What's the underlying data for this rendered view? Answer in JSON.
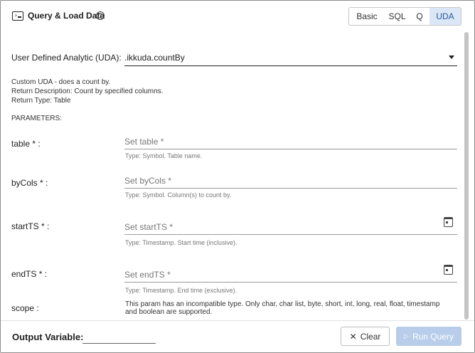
{
  "header": {
    "title": "Query & Load Data",
    "modes": [
      {
        "label": "Basic",
        "selected": false
      },
      {
        "label": "SQL",
        "selected": false
      },
      {
        "label": "Q",
        "selected": false
      },
      {
        "label": "UDA",
        "selected": true
      }
    ]
  },
  "uda": {
    "label": "User Defined Analytic (UDA):",
    "value": ".ikkuda.countBy",
    "description": [
      "Custom UDA - does a count by.",
      "Return Description: Count by specified columns.",
      "Return Type: Table"
    ],
    "parameters_heading": "PARAMETERS:"
  },
  "params": [
    {
      "label": "table * :",
      "placeholder": "Set table *",
      "hint": "Type: Symbol. Table name."
    },
    {
      "label": "byCols * :",
      "placeholder": "Set byCols *",
      "hint": "Type: Symbol. Column(s) to count by."
    },
    {
      "label": "startTS * :",
      "placeholder": "Set startTS *",
      "hint": "Type: Timestamp. Start time (inclusive)."
    },
    {
      "label": "endTS * :",
      "placeholder": "Set endTS *",
      "hint": "Type: Timestamp. End time (exclusive)."
    }
  ],
  "scope": {
    "label": "scope :",
    "message": "This param has an incompatible type. Only char, char list, byte, short, int, long, real, float, timestamp and boolean are supported."
  },
  "footer": {
    "output_label": "Output Variable:",
    "output_value": "",
    "clear_label": "Clear",
    "run_label": "Run Query"
  },
  "icons": {
    "header": "terminal-icon",
    "help": "help-circle-icon",
    "dropdown": "caret-down-icon",
    "calendar": "calendar-icon",
    "clear": "close-icon",
    "run": "play-icon"
  },
  "colors": {
    "selected_mode_bg": "#dbe7f7",
    "run_button_disabled": "#b7cdea"
  }
}
